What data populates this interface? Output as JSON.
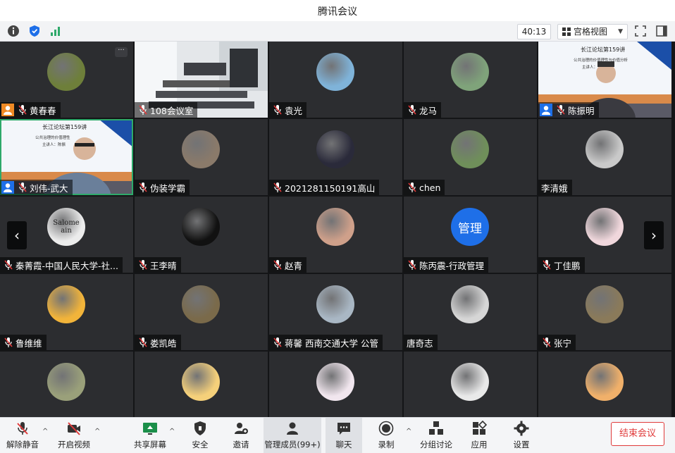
{
  "window": {
    "title": "腾讯会议"
  },
  "infobar": {
    "timer": "40:13",
    "view_label": "宫格视图"
  },
  "tiles": [
    {
      "name": "黄春春",
      "kind": "avatar",
      "avatar_color": "#6e7f3a",
      "host": "orange",
      "more": "···"
    },
    {
      "name": "108会议室",
      "kind": "room"
    },
    {
      "name": "袁光",
      "kind": "avatar",
      "avatar_color": "#7fb3d9"
    },
    {
      "name": "龙马",
      "kind": "avatar",
      "avatar_color": "#7fa37a"
    },
    {
      "name": "陈振明",
      "kind": "slide",
      "host": "blue",
      "slide_title": "长江论坛第159讲",
      "slide_sub": "公共治理的价值理性与价值分析",
      "slide_line3": "主讲人："
    },
    {
      "name": "刘伟-武大",
      "kind": "slide2",
      "host": "blue",
      "slide_title": "长江论坛第159讲",
      "slide_sub": "公共治理的价值理性",
      "slide_line3": "主讲人：陈振"
    },
    {
      "name": "伪装学霸",
      "kind": "avatar",
      "avatar_color": "#8a7a6a"
    },
    {
      "name": "2021281150191高山",
      "kind": "avatar",
      "avatar_color": "#2a2a3a"
    },
    {
      "name": "chen",
      "kind": "avatar",
      "avatar_color": "#6f8f5a"
    },
    {
      "name": "李清娥",
      "kind": "avatar",
      "avatar_color": "#c9c9c9",
      "nomic": true
    },
    {
      "name": "秦菁霞-中国人民大学-社...",
      "kind": "avatar",
      "avatar_color": "#ececec",
      "avatar_text": "Salome ain"
    },
    {
      "name": "王李晴",
      "kind": "avatar",
      "avatar_color": "#111111"
    },
    {
      "name": "赵青",
      "kind": "avatar",
      "avatar_color": "#cfa08a"
    },
    {
      "name": "陈丙震-行政管理",
      "kind": "textavatar",
      "avatar_color": "#1e6fe8",
      "avatar_text": "管理"
    },
    {
      "name": "丁佳鹏",
      "kind": "avatar",
      "avatar_color": "#f0d7dc"
    },
    {
      "name": "鲁维维",
      "kind": "avatar",
      "avatar_color": "#f2b43a"
    },
    {
      "name": "娄凯皓",
      "kind": "avatar",
      "avatar_color": "#7a6a4a"
    },
    {
      "name": "蒋馨 西南交通大学 公管",
      "kind": "avatar",
      "avatar_color": "#a9b7c4"
    },
    {
      "name": "唐奇志",
      "kind": "avatar",
      "avatar_color": "#d6d6d6",
      "nomic": true
    },
    {
      "name": "张宁",
      "kind": "avatar",
      "avatar_color": "#8a7a5a"
    },
    {
      "name": "",
      "kind": "avatar",
      "avatar_color": "#9aa07a"
    },
    {
      "name": "",
      "kind": "avatar",
      "avatar_color": "#f5d07a"
    },
    {
      "name": "",
      "kind": "avatar",
      "avatar_color": "#f1e6ee"
    },
    {
      "name": "",
      "kind": "avatar",
      "avatar_color": "#e9e9e9"
    },
    {
      "name": "",
      "kind": "avatar",
      "avatar_color": "#f0b06a"
    }
  ],
  "nav": {
    "prev": "‹",
    "next": "›"
  },
  "toolbar": {
    "unmute": "解除静音",
    "start_video": "开启视频",
    "share": "共享屏幕",
    "security": "安全",
    "invite": "邀请",
    "members": "管理成员(99+)",
    "chat": "聊天",
    "record": "录制",
    "breakout": "分组讨论",
    "apps": "应用",
    "settings": "设置",
    "end": "结束会议"
  },
  "colors": {
    "host_blue": "#1e6fe8",
    "host_orange": "#f08a24",
    "end_red": "#e03a3a",
    "speaker_green": "#2ea96a"
  }
}
